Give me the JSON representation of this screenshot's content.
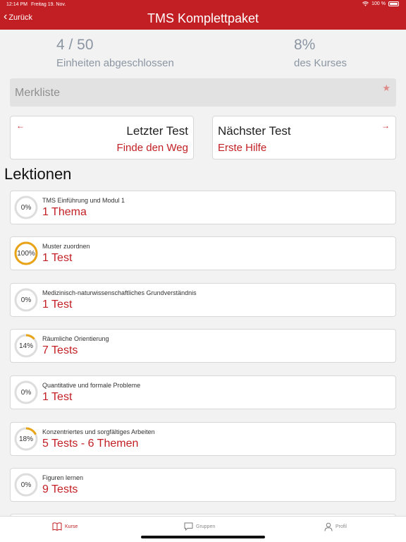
{
  "status": {
    "time": "12:14 PM",
    "date": "Freitag 19. Nov.",
    "battery": "100 %"
  },
  "header": {
    "back_label": "Zurück",
    "title": "TMS Komplettpaket"
  },
  "stats": {
    "units_value": "4 / 50",
    "units_label": "Einheiten abgeschlossen",
    "course_value": "8%",
    "course_label": "des Kurses"
  },
  "merkliste": {
    "label": "Merkliste",
    "star_icon": "star-icon"
  },
  "nav": {
    "prev": {
      "arrow": "←",
      "title": "Letzter Test",
      "subtitle": "Finde den Weg"
    },
    "next": {
      "arrow": "→",
      "title": "Nächster Test",
      "subtitle": "Erste Hilfe"
    }
  },
  "lessons_title": "Lektionen",
  "lessons": [
    {
      "name": "TMS Einführung und Modul 1",
      "count": "1 Thema",
      "percent_label": "0%",
      "progress": 0
    },
    {
      "name": "Muster zuordnen",
      "count": "1 Test",
      "percent_label": "100%",
      "progress": 1.0
    },
    {
      "name": "Medizinisch-naturwissenschaftliches Grundverständnis",
      "count": "1 Test",
      "percent_label": "0%",
      "progress": 0
    },
    {
      "name": "Räumliche Orientierung",
      "count": "7 Tests",
      "percent_label": "14%",
      "progress": 0.14
    },
    {
      "name": "Quantitative und formale Probleme",
      "count": "1 Test",
      "percent_label": "0%",
      "progress": 0
    },
    {
      "name": "Konzentriertes und sorgfältiges Arbeiten",
      "count": "5 Tests - 6 Themen",
      "percent_label": "18%",
      "progress": 0.18
    },
    {
      "name": "Figuren lernen",
      "count": "9 Tests",
      "percent_label": "0%",
      "progress": 0
    }
  ],
  "tabs": [
    {
      "label": "Kurse",
      "icon": "book-icon",
      "active": true
    },
    {
      "label": "Gruppen",
      "icon": "chat-icon",
      "active": false
    },
    {
      "label": "Profil",
      "icon": "person-icon",
      "active": false
    }
  ],
  "colors": {
    "accent": "#c21f24",
    "progress": "#e8a317",
    "track": "#dddddd"
  }
}
